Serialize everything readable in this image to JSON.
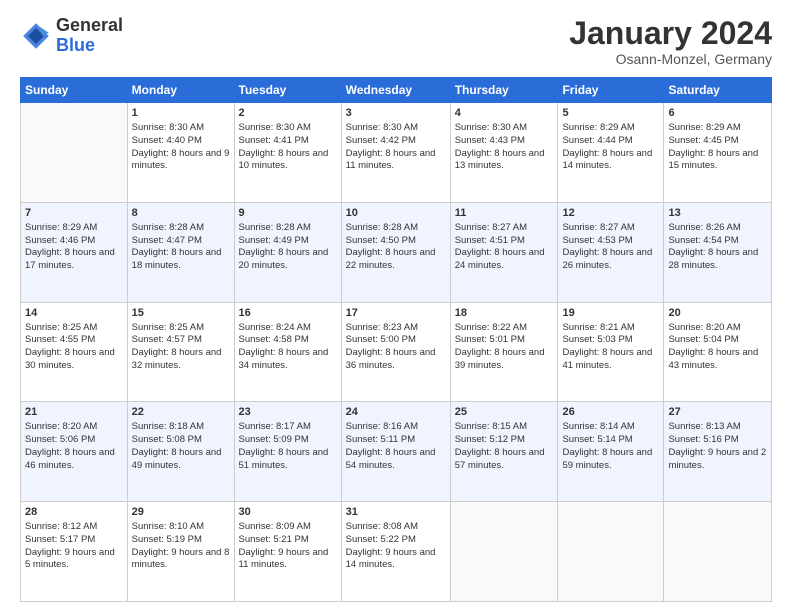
{
  "header": {
    "logo": {
      "general": "General",
      "blue": "Blue"
    },
    "title": "January 2024",
    "subtitle": "Osann-Monzel, Germany"
  },
  "days_of_week": [
    "Sunday",
    "Monday",
    "Tuesday",
    "Wednesday",
    "Thursday",
    "Friday",
    "Saturday"
  ],
  "weeks": [
    [
      {
        "day": null
      },
      {
        "day": 1,
        "sunrise": "8:30 AM",
        "sunset": "4:40 PM",
        "daylight": "8 hours and 9 minutes."
      },
      {
        "day": 2,
        "sunrise": "8:30 AM",
        "sunset": "4:41 PM",
        "daylight": "8 hours and 10 minutes."
      },
      {
        "day": 3,
        "sunrise": "8:30 AM",
        "sunset": "4:42 PM",
        "daylight": "8 hours and 11 minutes."
      },
      {
        "day": 4,
        "sunrise": "8:30 AM",
        "sunset": "4:43 PM",
        "daylight": "8 hours and 13 minutes."
      },
      {
        "day": 5,
        "sunrise": "8:29 AM",
        "sunset": "4:44 PM",
        "daylight": "8 hours and 14 minutes."
      },
      {
        "day": 6,
        "sunrise": "8:29 AM",
        "sunset": "4:45 PM",
        "daylight": "8 hours and 15 minutes."
      }
    ],
    [
      {
        "day": 7,
        "sunrise": "8:29 AM",
        "sunset": "4:46 PM",
        "daylight": "8 hours and 17 minutes."
      },
      {
        "day": 8,
        "sunrise": "8:28 AM",
        "sunset": "4:47 PM",
        "daylight": "8 hours and 18 minutes."
      },
      {
        "day": 9,
        "sunrise": "8:28 AM",
        "sunset": "4:49 PM",
        "daylight": "8 hours and 20 minutes."
      },
      {
        "day": 10,
        "sunrise": "8:28 AM",
        "sunset": "4:50 PM",
        "daylight": "8 hours and 22 minutes."
      },
      {
        "day": 11,
        "sunrise": "8:27 AM",
        "sunset": "4:51 PM",
        "daylight": "8 hours and 24 minutes."
      },
      {
        "day": 12,
        "sunrise": "8:27 AM",
        "sunset": "4:53 PM",
        "daylight": "8 hours and 26 minutes."
      },
      {
        "day": 13,
        "sunrise": "8:26 AM",
        "sunset": "4:54 PM",
        "daylight": "8 hours and 28 minutes."
      }
    ],
    [
      {
        "day": 14,
        "sunrise": "8:25 AM",
        "sunset": "4:55 PM",
        "daylight": "8 hours and 30 minutes."
      },
      {
        "day": 15,
        "sunrise": "8:25 AM",
        "sunset": "4:57 PM",
        "daylight": "8 hours and 32 minutes."
      },
      {
        "day": 16,
        "sunrise": "8:24 AM",
        "sunset": "4:58 PM",
        "daylight": "8 hours and 34 minutes."
      },
      {
        "day": 17,
        "sunrise": "8:23 AM",
        "sunset": "5:00 PM",
        "daylight": "8 hours and 36 minutes."
      },
      {
        "day": 18,
        "sunrise": "8:22 AM",
        "sunset": "5:01 PM",
        "daylight": "8 hours and 39 minutes."
      },
      {
        "day": 19,
        "sunrise": "8:21 AM",
        "sunset": "5:03 PM",
        "daylight": "8 hours and 41 minutes."
      },
      {
        "day": 20,
        "sunrise": "8:20 AM",
        "sunset": "5:04 PM",
        "daylight": "8 hours and 43 minutes."
      }
    ],
    [
      {
        "day": 21,
        "sunrise": "8:20 AM",
        "sunset": "5:06 PM",
        "daylight": "8 hours and 46 minutes."
      },
      {
        "day": 22,
        "sunrise": "8:18 AM",
        "sunset": "5:08 PM",
        "daylight": "8 hours and 49 minutes."
      },
      {
        "day": 23,
        "sunrise": "8:17 AM",
        "sunset": "5:09 PM",
        "daylight": "8 hours and 51 minutes."
      },
      {
        "day": 24,
        "sunrise": "8:16 AM",
        "sunset": "5:11 PM",
        "daylight": "8 hours and 54 minutes."
      },
      {
        "day": 25,
        "sunrise": "8:15 AM",
        "sunset": "5:12 PM",
        "daylight": "8 hours and 57 minutes."
      },
      {
        "day": 26,
        "sunrise": "8:14 AM",
        "sunset": "5:14 PM",
        "daylight": "8 hours and 59 minutes."
      },
      {
        "day": 27,
        "sunrise": "8:13 AM",
        "sunset": "5:16 PM",
        "daylight": "9 hours and 2 minutes."
      }
    ],
    [
      {
        "day": 28,
        "sunrise": "8:12 AM",
        "sunset": "5:17 PM",
        "daylight": "9 hours and 5 minutes."
      },
      {
        "day": 29,
        "sunrise": "8:10 AM",
        "sunset": "5:19 PM",
        "daylight": "9 hours and 8 minutes."
      },
      {
        "day": 30,
        "sunrise": "8:09 AM",
        "sunset": "5:21 PM",
        "daylight": "9 hours and 11 minutes."
      },
      {
        "day": 31,
        "sunrise": "8:08 AM",
        "sunset": "5:22 PM",
        "daylight": "9 hours and 14 minutes."
      },
      {
        "day": null
      },
      {
        "day": null
      },
      {
        "day": null
      }
    ]
  ]
}
